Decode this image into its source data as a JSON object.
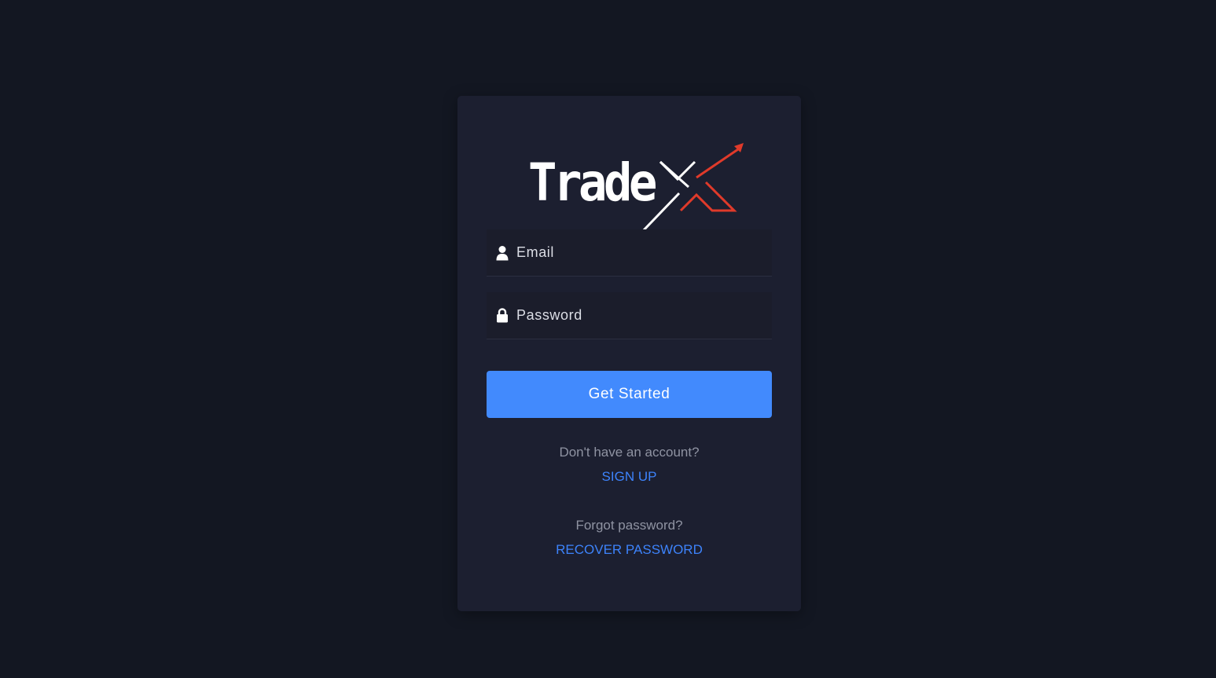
{
  "brand": {
    "logo_text": "Trade",
    "logo_mark": "X",
    "accent_color": "#e03a2a",
    "primary_color": "#428afd"
  },
  "form": {
    "email": {
      "placeholder": "Email",
      "value": "",
      "icon": "user-icon"
    },
    "password": {
      "placeholder": "Password",
      "value": "",
      "icon": "lock-icon"
    },
    "submit_label": "Get Started"
  },
  "signup": {
    "prompt": "Don't have an account?",
    "link_label": "SIGN UP"
  },
  "recover": {
    "prompt": "Forgot password?",
    "link_label": "RECOVER PASSWORD"
  }
}
